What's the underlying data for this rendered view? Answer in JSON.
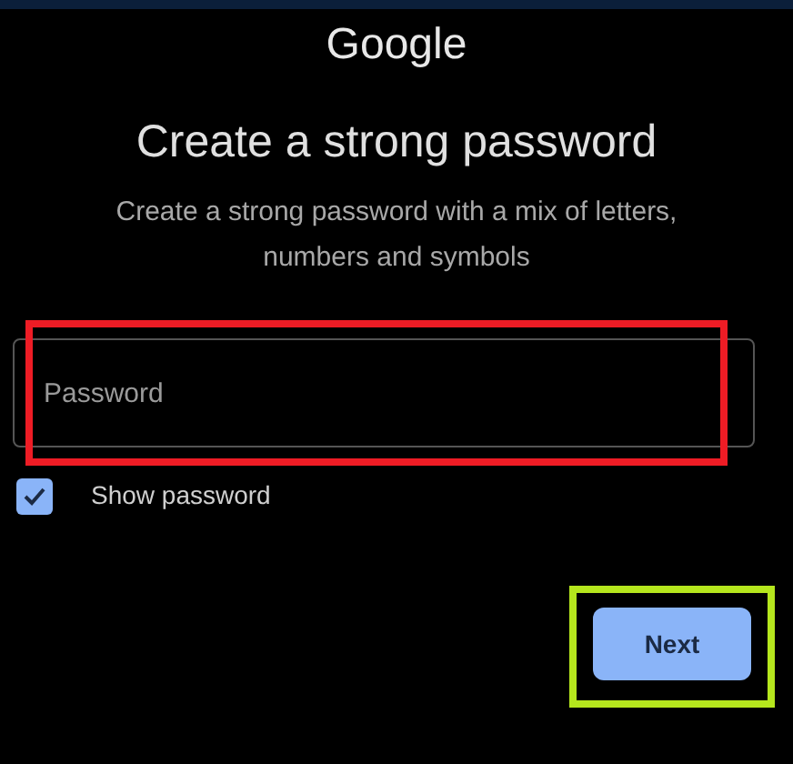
{
  "logo": "Google",
  "title": "Create a strong password",
  "subtitle": "Create a strong password with a mix of letters, numbers and symbols",
  "password_field": {
    "placeholder": "Password"
  },
  "show_password": {
    "label": "Show password",
    "checked": true
  },
  "buttons": [
    "Next"
  ]
}
